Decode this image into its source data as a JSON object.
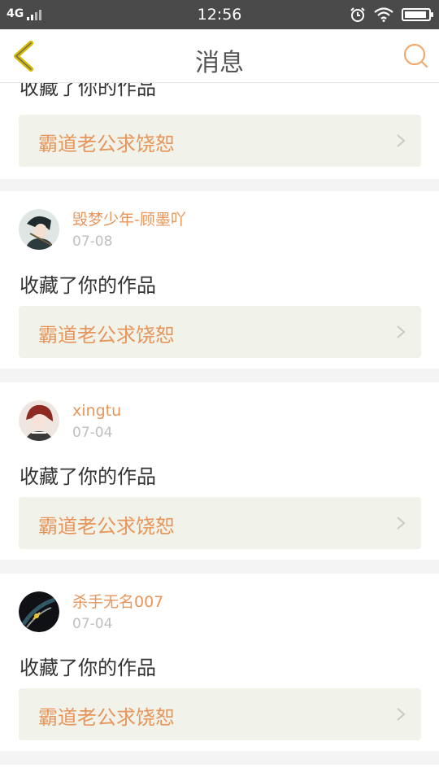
{
  "status_bar": {
    "network": "4G",
    "time": "12:56"
  },
  "nav": {
    "title": "消息"
  },
  "partial": {
    "action": "收藏了你的作品",
    "work_title": "霸道老公求饶恕"
  },
  "messages": [
    {
      "username": "毁梦少年-顾墨吖",
      "date": "07-08",
      "action": "收藏了你的作品",
      "work_title": "霸道老公求饶恕"
    },
    {
      "username": "xingtu",
      "date": "07-04",
      "action": "收藏了你的作品",
      "work_title": "霸道老公求饶恕"
    },
    {
      "username": "杀手无名007",
      "date": "07-04",
      "action": "收藏了你的作品",
      "work_title": "霸道老公求饶恕"
    }
  ],
  "colors": {
    "accent": "#e8955a",
    "back_icon": "#d7b800",
    "link_bg": "#f1f2ea"
  },
  "icons": {
    "back": "chevron-left-icon",
    "search": "search-icon",
    "link_arrow": "chevron-right-icon",
    "alarm": "alarm-icon",
    "wifi": "wifi-icon",
    "battery": "battery-icon"
  }
}
